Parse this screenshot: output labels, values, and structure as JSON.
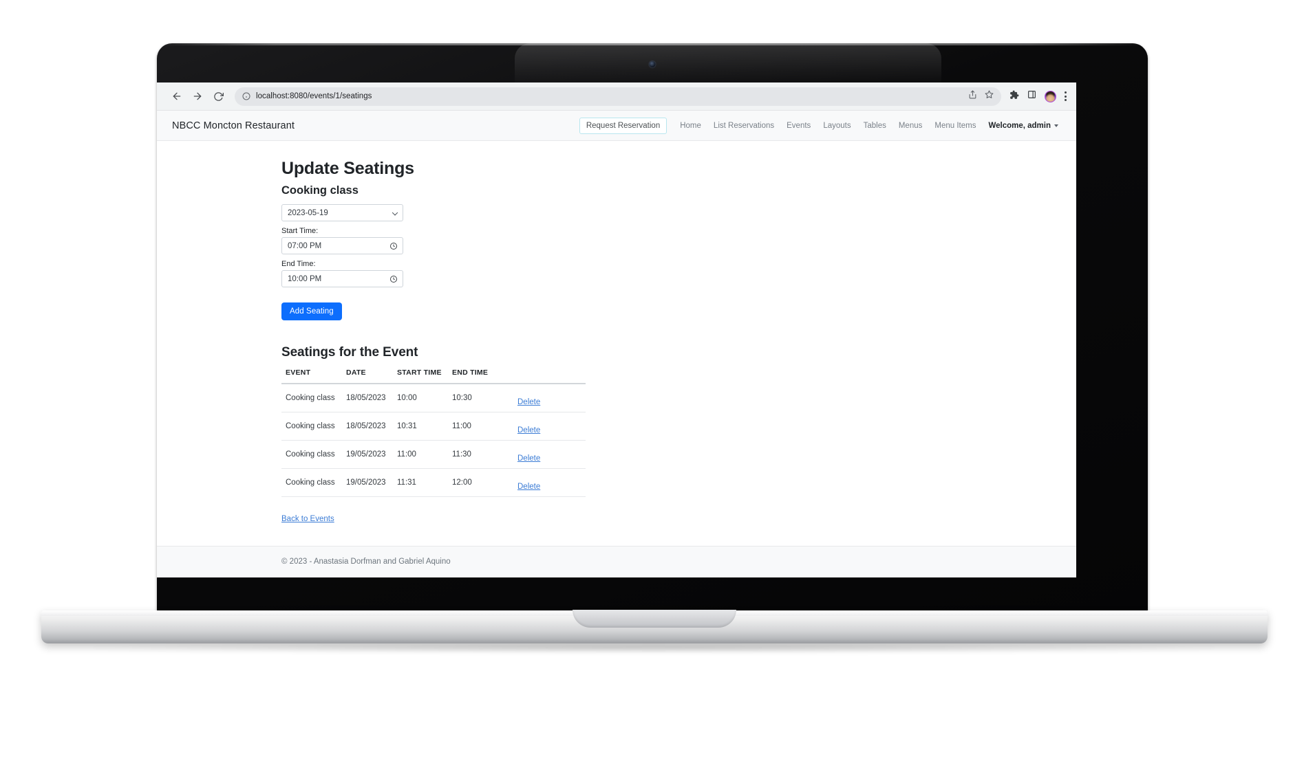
{
  "browser": {
    "url": "localhost:8080/events/1/seatings",
    "back_icon": "back-arrow-icon",
    "forward_icon": "forward-arrow-icon",
    "reload_icon": "reload-icon",
    "site_info_icon": "site-info-icon",
    "share_icon": "share-icon",
    "bookmark_icon": "star-icon",
    "extensions_icon": "puzzle-icon",
    "side_panel_icon": "side-panel-icon",
    "profile_icon": "profile-avatar-icon",
    "menu_icon": "kebab-menu-icon"
  },
  "navbar": {
    "brand": "NBCC Moncton Restaurant",
    "request_reservation": "Request Reservation",
    "links": [
      {
        "label": "Home"
      },
      {
        "label": "List Reservations"
      },
      {
        "label": "Events"
      },
      {
        "label": "Layouts"
      },
      {
        "label": "Tables"
      },
      {
        "label": "Menus"
      },
      {
        "label": "Menu Items"
      }
    ],
    "user": "Welcome, admin"
  },
  "page": {
    "title": "Update Seatings",
    "event_name": "Cooking class"
  },
  "form": {
    "date_select": {
      "value": "2023-05-19",
      "options": [
        "2023-05-19"
      ]
    },
    "start_time": {
      "label": "Start Time:",
      "value": "07:00 PM"
    },
    "end_time": {
      "label": "End Time:",
      "value": "10:00 PM"
    },
    "submit_label": "Add Seating"
  },
  "table": {
    "title": "Seatings for the Event",
    "columns": [
      "EVENT",
      "DATE",
      "START TIME",
      "END TIME",
      ""
    ],
    "rows": [
      {
        "event": "Cooking class",
        "date": "18/05/2023",
        "start": "10:00",
        "end": "10:30",
        "action": "Delete"
      },
      {
        "event": "Cooking class",
        "date": "18/05/2023",
        "start": "10:31",
        "end": "11:00",
        "action": "Delete"
      },
      {
        "event": "Cooking class",
        "date": "19/05/2023",
        "start": "11:00",
        "end": "11:30",
        "action": "Delete"
      },
      {
        "event": "Cooking class",
        "date": "19/05/2023",
        "start": "11:31",
        "end": "12:00",
        "action": "Delete"
      }
    ]
  },
  "links": {
    "back_to_events": "Back to Events"
  },
  "footer": {
    "text": "© 2023 - Anastasia Dorfman and Gabriel Aquino"
  },
  "colors": {
    "primary": "#0d6efd",
    "link": "#3a7bd5",
    "navbar_bg": "#f8f9fa",
    "request_btn_border": "#b8e6ef"
  }
}
